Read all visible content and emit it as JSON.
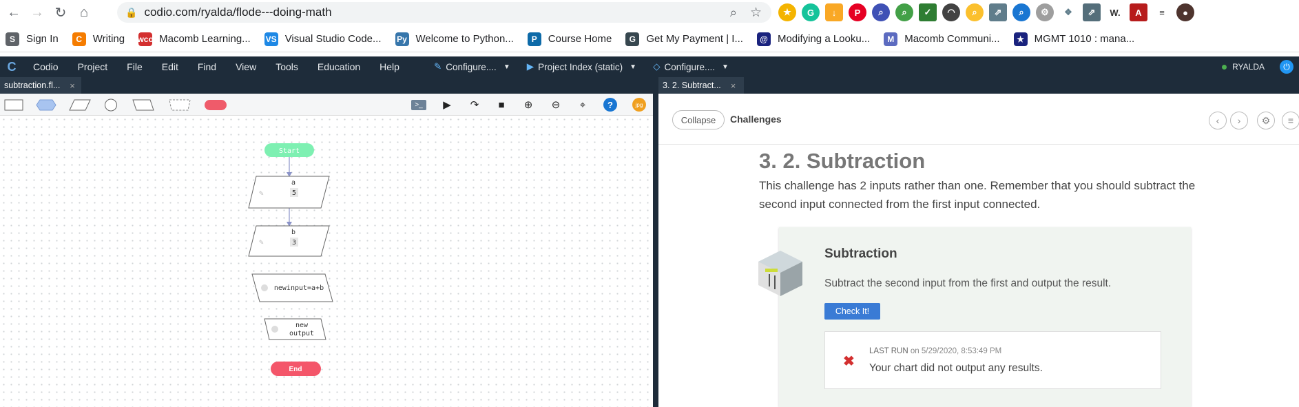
{
  "browser": {
    "url": "codio.com/ryalda/flode---doing-math",
    "bookmarks": [
      {
        "label": "Sign In",
        "color": "#5f6368"
      },
      {
        "label": "Writing",
        "color": "#f57c00"
      },
      {
        "label": "Macomb Learning...",
        "color": "#d32f2f"
      },
      {
        "label": "Visual Studio Code...",
        "color": "#1e88e5"
      },
      {
        "label": "Welcome to Python...",
        "color": "#3776ab"
      },
      {
        "label": "Course Home",
        "color": "#0d6aa8"
      },
      {
        "label": "Get My Payment | I...",
        "color": "#37474f"
      },
      {
        "label": "Modifying a Looku...",
        "color": "#1a237e"
      },
      {
        "label": "Macomb Communi...",
        "color": "#5c6bc0"
      },
      {
        "label": "MGMT 1010 : mana...",
        "color": "#1a237e"
      }
    ],
    "bm_icons": [
      "S",
      "C",
      "wco",
      "VS",
      "Py",
      "P",
      "G",
      "@",
      "M",
      "★"
    ]
  },
  "codio": {
    "menu": [
      "Codio",
      "Project",
      "File",
      "Edit",
      "Find",
      "View",
      "Tools",
      "Education",
      "Help"
    ],
    "dropdowns": [
      "Configure....",
      "Project Index (static)",
      "Configure...."
    ],
    "user": "RYALDA"
  },
  "left": {
    "tab": "subtraction.fl...",
    "flow": {
      "start": "Start",
      "input_a": {
        "name": "a",
        "value": "5"
      },
      "input_b": {
        "name": "b",
        "value": "3"
      },
      "process": "newinput=a+b",
      "output": [
        "new",
        "output"
      ],
      "end": "End"
    }
  },
  "right": {
    "tab": "3. 2. Subtract...",
    "collapse": "Collapse",
    "challenges": "Challenges",
    "title": "3. 2. Subtraction",
    "intro": "This challenge has 2 inputs rather than one. Remember that you should subtract the second input connected from the first input connected.",
    "card": {
      "title": "Subtraction",
      "desc": "Subtract the second input from the first and output the result.",
      "check": "Check It!",
      "last_run_label": "LAST RUN",
      "last_run_time": "on 5/29/2020, 8:53:49 PM",
      "message": "Your chart did not output any results."
    }
  }
}
